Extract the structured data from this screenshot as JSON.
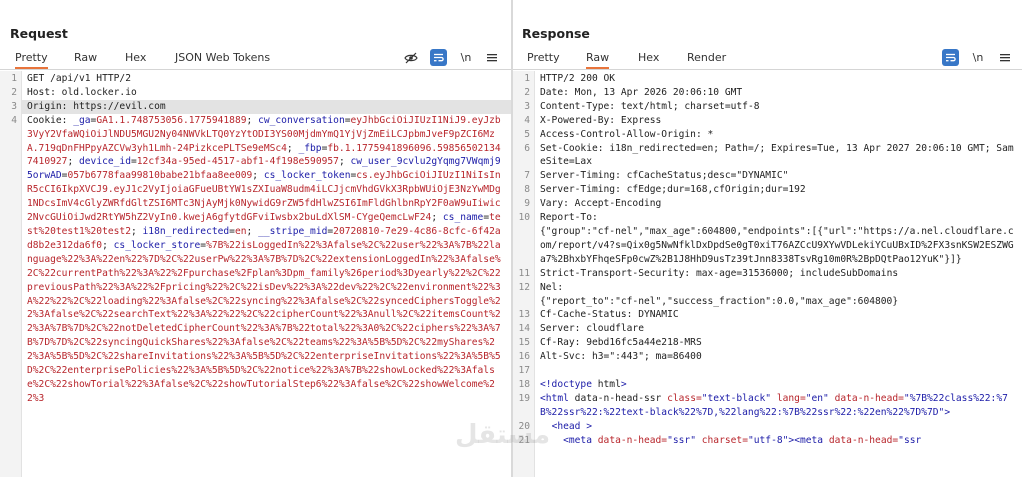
{
  "request": {
    "title": "Request",
    "tabs": [
      {
        "label": "Pretty",
        "active": true
      },
      {
        "label": "Raw",
        "active": false
      },
      {
        "label": "Hex",
        "active": false
      },
      {
        "label": "JSON Web Tokens",
        "active": false
      }
    ],
    "tools": {
      "newline_label": "\\n"
    },
    "lines": [
      {
        "n": "1",
        "text": "GET /api/v1 HTTP/2"
      },
      {
        "n": "2",
        "text": "Host: old.locker.io"
      },
      {
        "n": "3",
        "text": "Origin: https://evil.com"
      },
      {
        "n": "4",
        "text": "Cookie: _ga=GA1.1.748753056.1775941889; cw_conversation=eyJhbGciOiJIUzI1NiJ9.eyJzb3VyY2VfaWQiOiJlNDU5MGU2Ny04NWVkLTQ0YzYtODI3YS00MjdmYmQ1YjVjZmEiLCJpbmJveF9pZCI6MzA.719qDnFHPpyAZCVw3yh1Lmh-24PizkcePLTSe9eMSc4; _fbp=fb.1.1775941896096.598565021347410927; device_id=12cf34a-95ed-4517-abf1-4f198e590957; cw_user_9cvlu2gYqmg7VWqmj95orwAD=057b6778faa99810babe21bfaa8ee009; cs_locker_token=cs.eyJhbGciOiJIUzI1NiIsInR5cCI6IkpXVCJ9.eyJ1c2VyIjoiaGFueUBtYW1sZXIuaW8udm4iLCJjcmVhdGVkX3RpbWUiOjE3NzYwMDg1NDcsImV4cGlyZWRfdGltZSI6MTc3NjAyMjk0NywidG9rZW5fdHlwZSI6ImFldGhlbnRpY2F0aW9uIiwic2NvcGUiOiJwd2RtYW5hZ2VyIn0.kwejA6gfytdGFviIwsbx2buLdXlSM-CYgeQemcLwF24; cs_name=test%20test1%20test2; i18n_redirected=en; __stripe_mid=20720810-7e29-4c86-8cfc-6f42ad8b2e312da6f0; cs_locker_store=%7B%22isLoggedIn%22%3Afalse%2C%22user%22%3A%7B%22language%22%3A%22en%22%7D%2C%22userPw%22%3A%7B%7D%2C%22extensionLoggedIn%22%3Afalse%2C%22currentPath%22%3A%22%2Fpurchase%2Fplan%3Dpm_family%26period%3Dyearly%22%2C%22previousPath%22%3A%22%2Fpricing%22%2C%22isDev%22%3A%22dev%22%2C%22environment%22%3A%22%22%2C%22loading%22%3Afalse%2C%22syncing%22%3Afalse%2C%22syncedCiphersToggle%22%3Afalse%2C%22searchText%22%3A%22%22%2C%22cipherCount%22%3Anull%2C%22itemsCount%22%3A%7B%7D%2C%22notDeletedCipherCount%22%3A%7B%22total%22%3A0%2C%22ciphers%22%3A%7B%7D%7D%2C%22syncingQuickShares%22%3Afalse%2C%22teams%22%3A%5B%5D%2C%22myShares%22%3A%5B%5D%2C%22shareInvitations%22%3A%5B%5D%2C%22enterpriseInvitations%22%3A%5B%5D%2C%22enterprisePolicies%22%3A%5B%5D%2C%22notice%22%3A%7B%22showLocked%22%3Afalse%2C%22showTorial%22%3Afalse%2C%22showTutorialStep6%22%3Afalse%2C%22showWelcome%22%3"
      }
    ]
  },
  "response": {
    "title": "Response",
    "tabs": [
      {
        "label": "Pretty",
        "active": false
      },
      {
        "label": "Raw",
        "active": true
      },
      {
        "label": "Hex",
        "active": false
      },
      {
        "label": "Render",
        "active": false
      }
    ],
    "tools": {
      "newline_label": "\\n"
    },
    "lines": [
      {
        "n": "1",
        "key": "",
        "val": "HTTP/2 200 OK"
      },
      {
        "n": "2",
        "key": "Date:",
        "val": " Mon, 13 Apr 2026 20:06:10 GMT"
      },
      {
        "n": "3",
        "key": "Content-Type:",
        "val": " text/html; charset=utf-8"
      },
      {
        "n": "4",
        "key": "X-Powered-By:",
        "val": " Express"
      },
      {
        "n": "5",
        "key": "Access-Control-Allow-Origin:",
        "val": " *"
      },
      {
        "n": "6",
        "key": "Set-Cookie:",
        "val": " i18n_redirected=en; Path=/; Expires=Tue, 13 Apr 2027 20:06:10 GMT; SameSite=Lax"
      },
      {
        "n": "7",
        "key": "Server-Timing:",
        "val": " cfCacheStatus;desc=\"DYNAMIC\""
      },
      {
        "n": "8",
        "key": "Server-Timing:",
        "val": " cfEdge;dur=168,cfOrigin;dur=192"
      },
      {
        "n": "9",
        "key": "Vary:",
        "val": " Accept-Encoding"
      },
      {
        "n": "10",
        "key": "Report-To:",
        "val": "\n{\"group\":\"cf-nel\",\"max_age\":604800,\"endpoints\":[{\"url\":\"https://a.nel.cloudflare.com/report/v4?s=Qix0g5NwNfklDxDpdSe0gT0xiT76AZCcU9XYwVDLekiYCuUBxID%2FX3snKSW2ESZWGa7%2BhxbYFhqeSFp0cwZ%2B1J8HhD9usTz39tJnn8338TsvRg10m0R%2BpDQtPao12YuK\"}]}"
      },
      {
        "n": "11",
        "key": "Strict-Transport-Security:",
        "val": " max-age=31536000; includeSubDomains"
      },
      {
        "n": "12",
        "key": "Nel:",
        "val": "\n{\"report_to\":\"cf-nel\",\"success_fraction\":0.0,\"max_age\":604800}"
      },
      {
        "n": "13",
        "key": "Cf-Cache-Status:",
        "val": " DYNAMIC"
      },
      {
        "n": "14",
        "key": "Server:",
        "val": " cloudflare"
      },
      {
        "n": "15",
        "key": "Cf-Ray:",
        "val": " 9ebd16fc5a44e218-MRS"
      },
      {
        "n": "16",
        "key": "Alt-Svc:",
        "val": " h3=\":443\"; ma=86400"
      },
      {
        "n": "17",
        "key": "",
        "val": ""
      },
      {
        "n": "18",
        "key": "",
        "val": "<!doctype html>"
      },
      {
        "n": "19",
        "key": "",
        "val": "<html data-n-head-ssr class=\"text-black\" lang=\"en\" data-n-head=\"%7B%22class%22:%7B%22ssr%22:%22text-black%22%7D,%22lang%22:%7B%22ssr%22:%22en%22%7D%7D\">"
      },
      {
        "n": "20",
        "key": "",
        "val": "  <head >"
      },
      {
        "n": "21",
        "key": "",
        "val": "    <meta data-n-head=\"ssr\" charset=\"utf-8\"><meta data-n-head=\"ssr"
      }
    ]
  },
  "icons": {
    "eye_off": "eye-off-icon",
    "wrap": "wrap-icon",
    "menu": "menu-icon"
  },
  "watermark": "ﻣﺴﺘﻘﻞ"
}
